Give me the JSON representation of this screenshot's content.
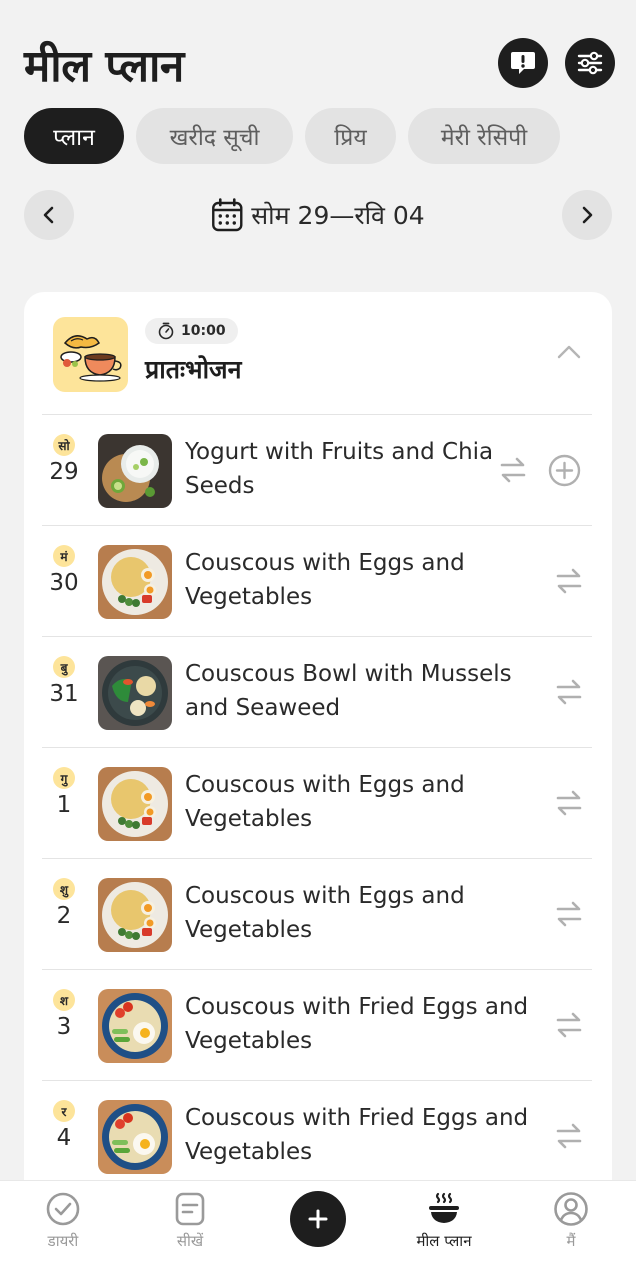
{
  "header": {
    "title": "मील प्लान",
    "alert_icon": "alert-icon",
    "settings_icon": "sliders-icon"
  },
  "tabs": [
    {
      "label": "प्लान",
      "active": true
    },
    {
      "label": "खरीद सूची",
      "active": false
    },
    {
      "label": "प्रिय",
      "active": false
    },
    {
      "label": "मेरी रेसिपी",
      "active": false
    }
  ],
  "week": {
    "label": "सोम 29—रवि 04",
    "prev_icon": "chevron-left-icon",
    "next_icon": "chevron-right-icon",
    "calendar_icon": "calendar-icon"
  },
  "meal": {
    "time": "10:00",
    "name": "प्रातःभोजन",
    "expanded": true,
    "rows": [
      {
        "day": "सो",
        "date": "29",
        "title": "Yogurt with Fruits and Chia Seeds",
        "thumb": "yogurt",
        "addable": true
      },
      {
        "day": "मं",
        "date": "30",
        "title": "Couscous with Eggs and Vegetables",
        "thumb": "couscous-eggs",
        "addable": false
      },
      {
        "day": "बु",
        "date": "31",
        "title": "Couscous Bowl with Mussels and Seaweed",
        "thumb": "couscous-mussels",
        "addable": false
      },
      {
        "day": "गु",
        "date": "1",
        "title": "Couscous with Eggs and Vegetables",
        "thumb": "couscous-eggs",
        "addable": false
      },
      {
        "day": "शु",
        "date": "2",
        "title": "Couscous with Eggs and Vegetables",
        "thumb": "couscous-eggs",
        "addable": false
      },
      {
        "day": "श",
        "date": "3",
        "title": "Couscous with Fried Eggs and Vegetables",
        "thumb": "couscous-fried",
        "addable": false
      },
      {
        "day": "र",
        "date": "4",
        "title": "Couscous with Fried Eggs and Vegetables",
        "thumb": "couscous-fried",
        "addable": false
      }
    ]
  },
  "bottom_nav": [
    {
      "label": "डायरी",
      "icon": "check-circle-icon",
      "active": false
    },
    {
      "label": "सीखें",
      "icon": "note-icon",
      "active": false
    },
    {
      "label": "",
      "icon": "plus-icon",
      "active": false
    },
    {
      "label": "मील प्लान",
      "icon": "bowl-icon",
      "active": true
    },
    {
      "label": "मैं",
      "icon": "user-icon",
      "active": false
    }
  ],
  "colors": {
    "background": "#f2f2f2",
    "dark": "#1e1e1e",
    "chip": "#e3e3e3",
    "accent_yellow": "#fde49a",
    "icon_gray": "#9a9a9a"
  }
}
